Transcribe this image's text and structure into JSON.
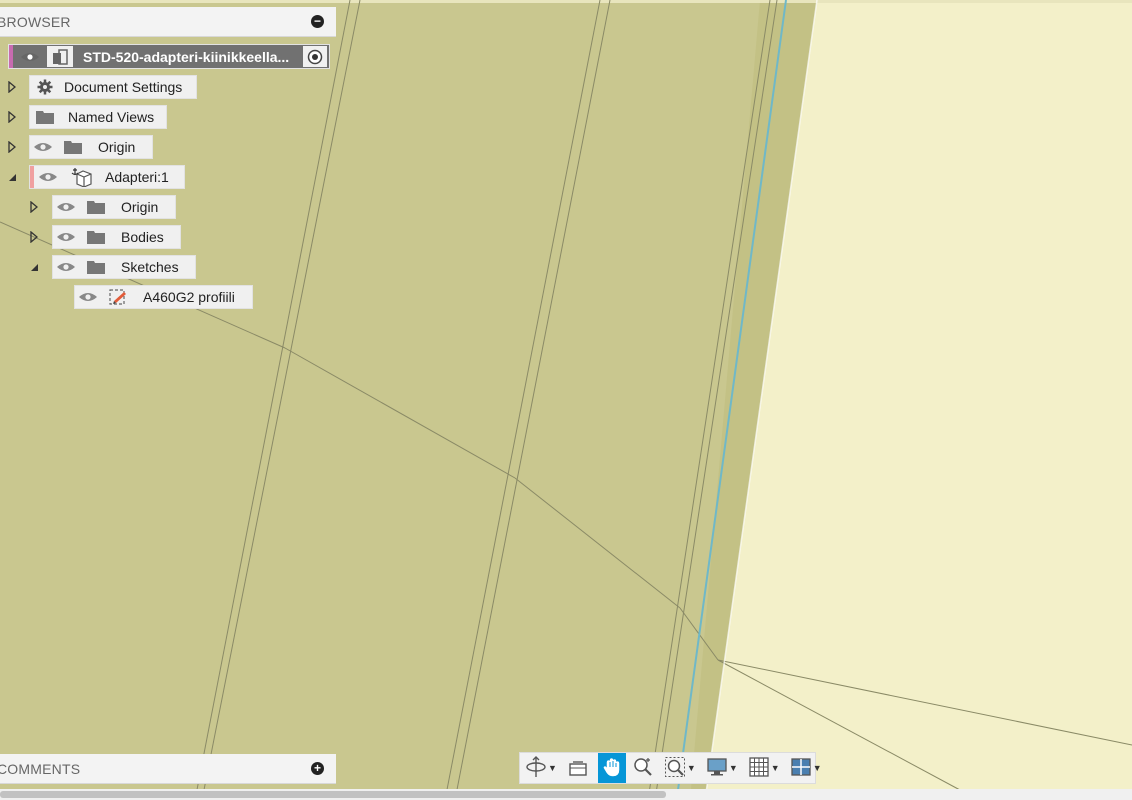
{
  "browser": {
    "title": "BROWSER",
    "collapse_icon": "minus-circle-icon",
    "root": {
      "label": "STD-520-adapteri-kiinikkeella...",
      "accent": "#c86bb0"
    },
    "items": [
      {
        "label": "Document Settings",
        "icon": "gear-icon"
      },
      {
        "label": "Named Views",
        "icon": "folder-icon"
      },
      {
        "label": "Origin",
        "icon": "folder-icon"
      },
      {
        "label": "Adapteri:1",
        "icon": "component-anchor-icon",
        "accent": "#f0a0a0"
      },
      {
        "label": "Origin",
        "icon": "folder-icon"
      },
      {
        "label": "Bodies",
        "icon": "folder-icon"
      },
      {
        "label": "Sketches",
        "icon": "folder-icon"
      },
      {
        "label": "A460G2 profiili",
        "icon": "sketch-icon"
      }
    ]
  },
  "comments": {
    "title": "COMMENTS",
    "expand_icon": "plus-circle-icon"
  },
  "toolbar": {
    "buttons": [
      {
        "name": "orbit",
        "icon": "orbit-icon",
        "dropdown": true
      },
      {
        "name": "look-at",
        "icon": "look-at-icon",
        "dropdown": false
      },
      {
        "name": "pan",
        "icon": "pan-hand-icon",
        "dropdown": false,
        "active": true
      },
      {
        "name": "zoom",
        "icon": "zoom-icon",
        "dropdown": false
      },
      {
        "name": "fit",
        "icon": "zoom-window-icon",
        "dropdown": true
      },
      {
        "name": "display-settings",
        "icon": "monitor-icon",
        "dropdown": true
      },
      {
        "name": "grid-snaps",
        "icon": "grid-icon",
        "dropdown": true
      },
      {
        "name": "viewports",
        "icon": "viewports-icon",
        "dropdown": true
      }
    ]
  },
  "colors": {
    "model_face": "#c9c78f",
    "background": "#f3f0c9",
    "active": "#0696d7",
    "edge_highlight": "#6fb8c8"
  }
}
